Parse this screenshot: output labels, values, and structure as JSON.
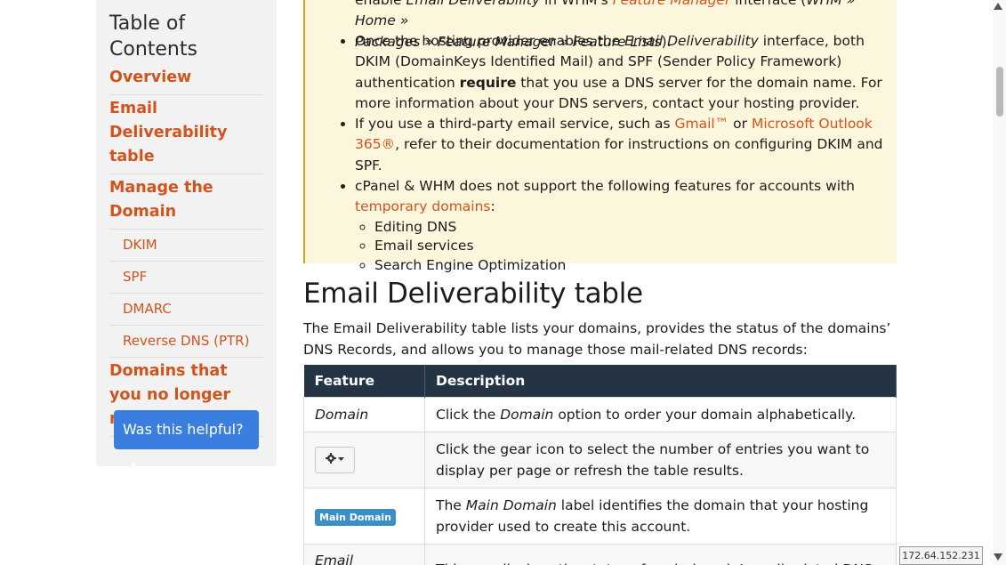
{
  "toc": {
    "title": "Table of Contents",
    "items": [
      {
        "label": "Overview",
        "level": 1
      },
      {
        "label": "Email Deliverability table",
        "level": 1
      },
      {
        "label": "Manage the Domain",
        "level": 1
      },
      {
        "label": "DKIM",
        "level": 2
      },
      {
        "label": "SPF",
        "level": 2
      },
      {
        "label": "DMARC",
        "level": 2
      },
      {
        "label": "Reverse DNS (PTR)",
        "level": 2
      },
      {
        "label": "Domains that you no longer manage",
        "level": 1
      }
    ],
    "help_button": "Was this helpful?"
  },
  "callout": {
    "line0_pre": "enable ",
    "line0_em": "Email Deliverability",
    "line0_mid": " in WHM's ",
    "line0_link": "Feature Manager",
    "line0_post1": " interface (",
    "line0_path": "WHM » Home »",
    "line1_path": "Packages » Feature Manager » Feature Lists",
    "line1_post": ").",
    "b1_pre": "Once the hosting provider enables the ",
    "b1_em": "Email Deliverability",
    "b1_mid": " interface, both DKIM (DomainKeys Identified Mail) and SPF (Sender Policy Framework) authentication ",
    "b1_strong": "require",
    "b1_post": " that you use a DNS server for the domain name. For more information about your DNS servers, contact your hosting provider.",
    "b2_pre": "If you use a third-party email service, such as ",
    "b2_link1": "Gmail™",
    "b2_or": " or ",
    "b2_link2": "Microsoft Outlook 365®",
    "b2_post": ", refer to their documentation for instructions on configuring DKIM and SPF.",
    "b3_pre": "cPanel & WHM does not support the following features for accounts with ",
    "b3_link": "temporary domains",
    "b3_post": ":",
    "sub_items": [
      "Editing DNS",
      "Email services",
      "Search Engine Optimization"
    ]
  },
  "section": {
    "heading": "Email Deliverability table",
    "intro": "The Email Deliverability table lists your domains, provides the status of the domains’ DNS Records, and allows you to manage those mail-related DNS records:"
  },
  "table": {
    "headers": [
      "Feature",
      "Description"
    ],
    "rows": {
      "r1": {
        "feature": "Domain",
        "d_pre": "Click the ",
        "d_em": "Domain",
        "d_post": " option to order your domain alphabetically."
      },
      "r2": {
        "feature_icon": "gear-icon",
        "desc": "Click the gear icon to select the number of entries you want to display per page or refresh the table results."
      },
      "r3": {
        "badge": "Main Domain",
        "d_pre": "The ",
        "d_em": "Main Domain",
        "d_post": " label identifies the domain that your hosting provider used to create this account."
      },
      "r4": {
        "feature": "Email",
        "desc": "This row displays the status of each domain’s mail-related DNS"
      }
    }
  },
  "ip_address": "172.64.152.231",
  "colors": {
    "accent": "#d0541e",
    "callout_bg": "#fcf6dc",
    "table_header": "#243444",
    "button": "#3a7ee0"
  }
}
